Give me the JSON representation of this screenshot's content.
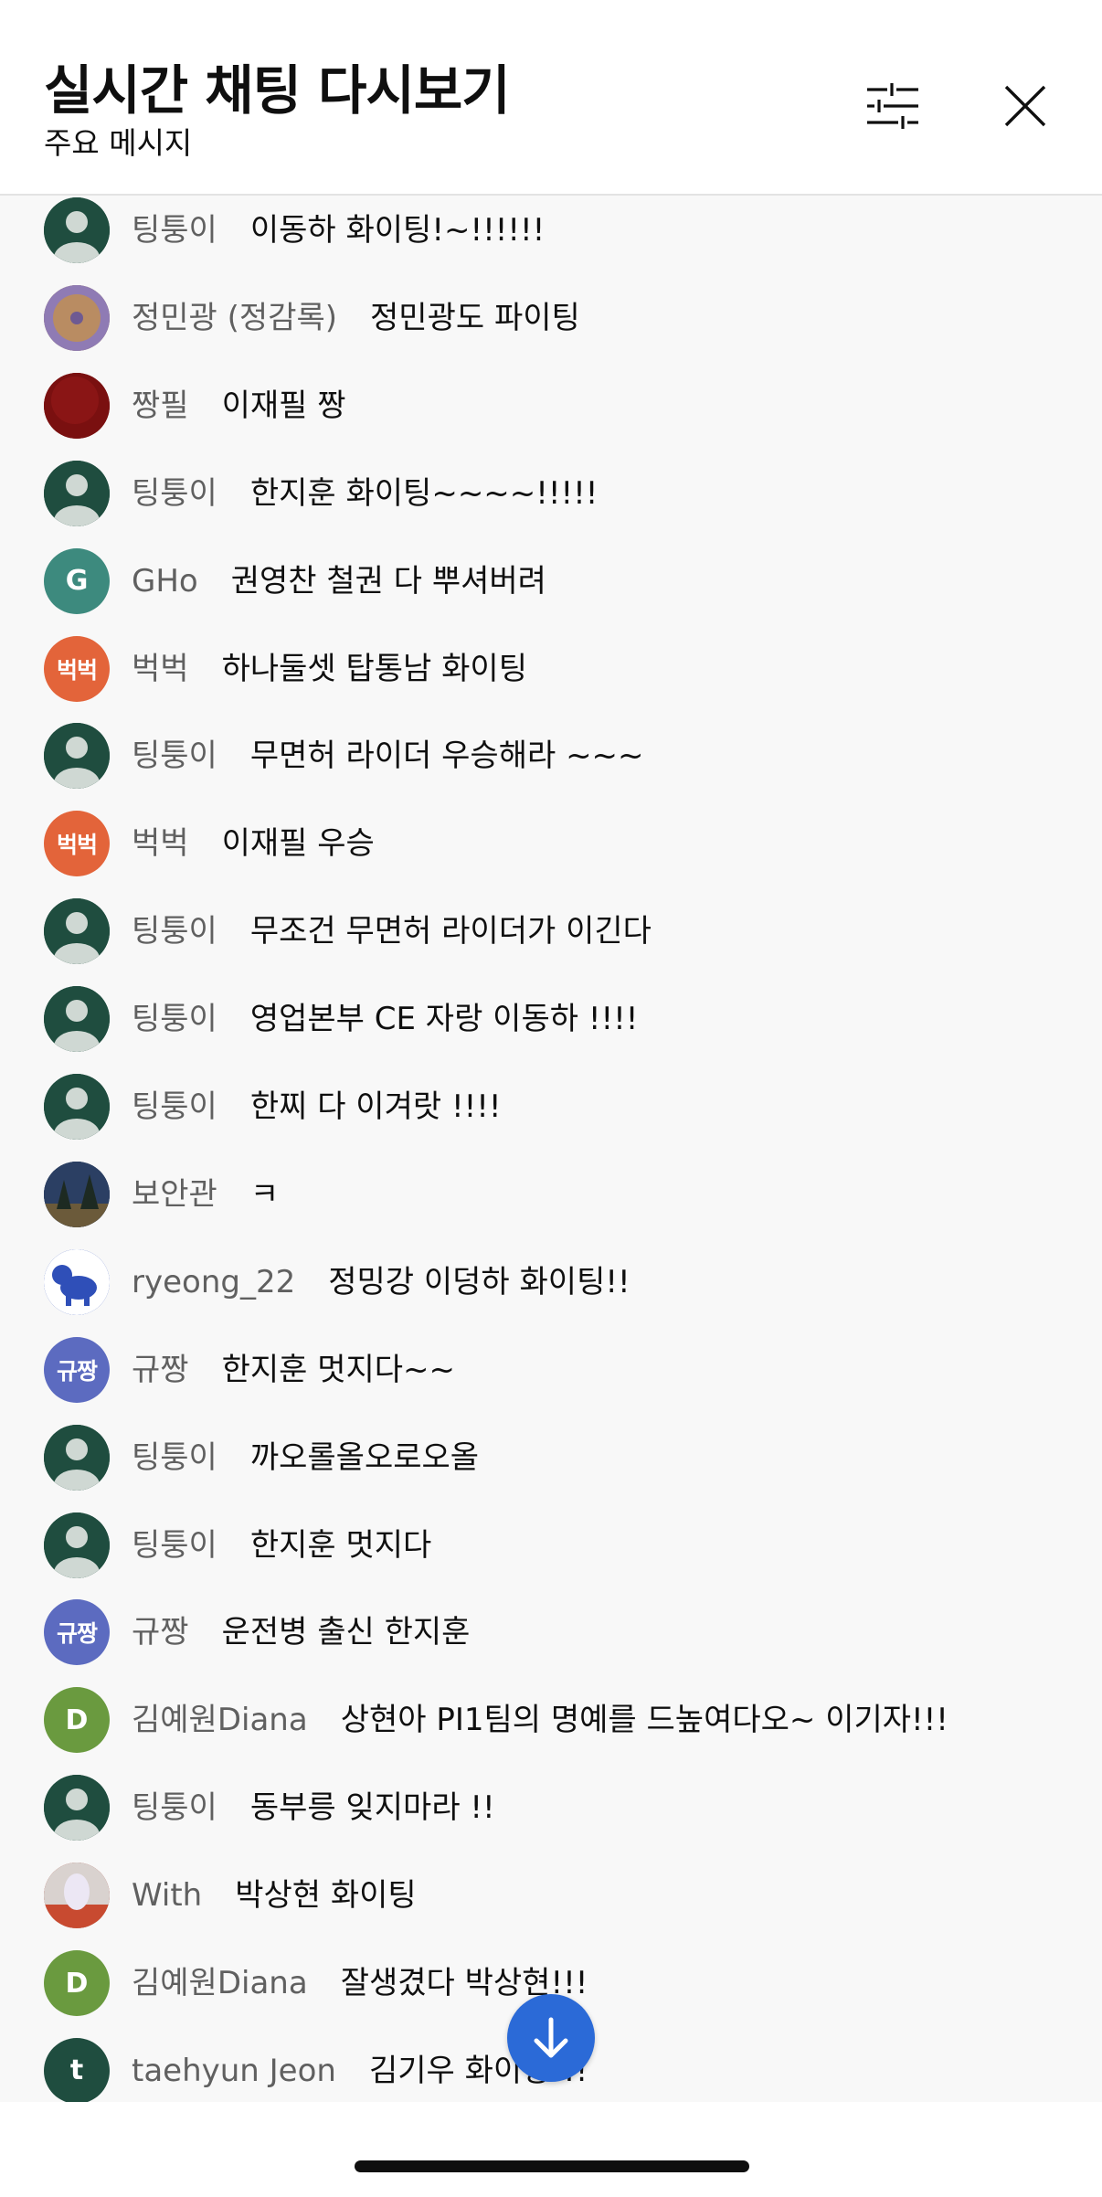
{
  "header": {
    "title": "실시간 채팅 다시보기",
    "subtitle": "주요 메시지"
  },
  "messages": [
    {
      "author": "팅퉁이",
      "text": "이동하 화이팅!~!!!!!!",
      "avatar": {
        "type": "default-user-icon",
        "color": "#1f4d3f"
      }
    },
    {
      "author": "정민광 (정감록)",
      "text": "정민광도 파이팅",
      "avatar": {
        "type": "photo-bagel",
        "color": "#a0826d"
      }
    },
    {
      "author": "짱필",
      "text": "이재필 짱",
      "avatar": {
        "type": "photo-red",
        "color": "#7a1010"
      }
    },
    {
      "author": "팅퉁이",
      "text": "한지훈 화이팅~~~~!!!!!",
      "avatar": {
        "type": "default-user-icon",
        "color": "#1f4d3f"
      }
    },
    {
      "author": "GHo",
      "text": "권영찬 철권 다 뿌셔버려",
      "avatar": {
        "type": "initial",
        "initial": "G",
        "color": "#3d8a7e"
      }
    },
    {
      "author": "벅벅",
      "text": "하나둘셋 탑통남 화이팅",
      "avatar": {
        "type": "initial",
        "initial": "벅벅",
        "color": "#e3643a"
      }
    },
    {
      "author": "팅퉁이",
      "text": "무면허 라이더 우승해라 ~~~",
      "avatar": {
        "type": "default-user-icon",
        "color": "#1f4d3f"
      }
    },
    {
      "author": "벅벅",
      "text": "이재필 우승",
      "avatar": {
        "type": "initial",
        "initial": "벅벅",
        "color": "#e3643a"
      }
    },
    {
      "author": "팅퉁이",
      "text": "무조건 무면허 라이더가 이긴다",
      "avatar": {
        "type": "default-user-icon",
        "color": "#1f4d3f"
      }
    },
    {
      "author": "팅퉁이",
      "text": "영업본부 CE 자랑 이동하 !!!!",
      "avatar": {
        "type": "default-user-icon",
        "color": "#1f4d3f"
      }
    },
    {
      "author": "팅퉁이",
      "text": "한찌 다 이겨랏 !!!!",
      "avatar": {
        "type": "default-user-icon",
        "color": "#1f4d3f"
      }
    },
    {
      "author": "보안관",
      "text": "ㅋ",
      "avatar": {
        "type": "photo-night",
        "color": "#2b3d5a"
      }
    },
    {
      "author": "ryeong_22",
      "text": "정밍강 이덩하 화이팅!!",
      "avatar": {
        "type": "photo-blue-dog",
        "color": "#2f4fb8"
      }
    },
    {
      "author": "규짱",
      "text": "한지훈 멋지다~~",
      "avatar": {
        "type": "initial",
        "initial": "규짱",
        "color": "#5c6bc0"
      }
    },
    {
      "author": "팅퉁이",
      "text": "까오롤올오로오올",
      "avatar": {
        "type": "default-user-icon",
        "color": "#1f4d3f"
      }
    },
    {
      "author": "팅퉁이",
      "text": "한지훈 멋지다",
      "avatar": {
        "type": "default-user-icon",
        "color": "#1f4d3f"
      }
    },
    {
      "author": "규짱",
      "text": "운전병 출신 한지훈",
      "avatar": {
        "type": "initial",
        "initial": "규짱",
        "color": "#5c6bc0"
      }
    },
    {
      "author": "김예원Diana",
      "text": "상현아 PI1팀의 명예를 드높여다오~ 이기자!!!",
      "avatar": {
        "type": "initial",
        "initial": "D",
        "color": "#6a9a3f"
      }
    },
    {
      "author": "팅퉁이",
      "text": "동부릉 잊지마라 !!",
      "avatar": {
        "type": "default-user-icon",
        "color": "#1f4d3f"
      }
    },
    {
      "author": "With",
      "text": "박상현 화이팅",
      "avatar": {
        "type": "photo-with",
        "color": "#b0584a"
      }
    },
    {
      "author": "김예원Diana",
      "text": "잘생겼다 박상현!!!",
      "avatar": {
        "type": "initial",
        "initial": "D",
        "color": "#6a9a3f"
      }
    },
    {
      "author": "taehyun Jeon",
      "text": "김기우 화이팅!!!",
      "avatar": {
        "type": "initial",
        "initial": "t",
        "color": "#1f4d3f"
      }
    }
  ],
  "colors": {
    "accent": "#2b6ad7",
    "author": "#606060",
    "chat_bg": "#f8f8f8"
  },
  "icons": {
    "filter": "sliders-icon",
    "close": "close-icon",
    "scroll_down": "arrow-down-icon"
  }
}
